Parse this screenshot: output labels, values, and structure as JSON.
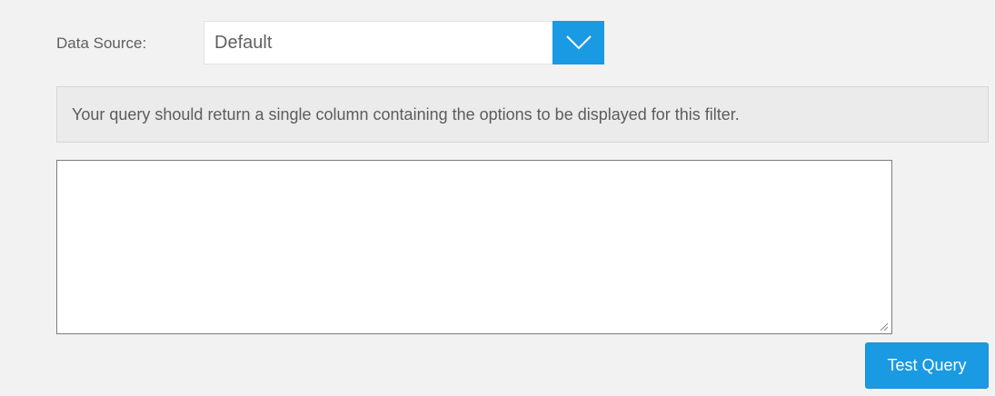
{
  "filter_query": {
    "data_source_label": "Data Source:",
    "data_source_value": "Default",
    "info_message": "Your query should return a single column containing the options to be displayed for this filter.",
    "query_text": "",
    "test_button_label": "Test Query"
  },
  "icons": {
    "dropdown": "chevron-down-icon",
    "resize": "resize-grip-icon"
  },
  "colors": {
    "accent": "#1a9ae2",
    "background": "#f2f2f2",
    "info_background": "#ebebeb"
  }
}
